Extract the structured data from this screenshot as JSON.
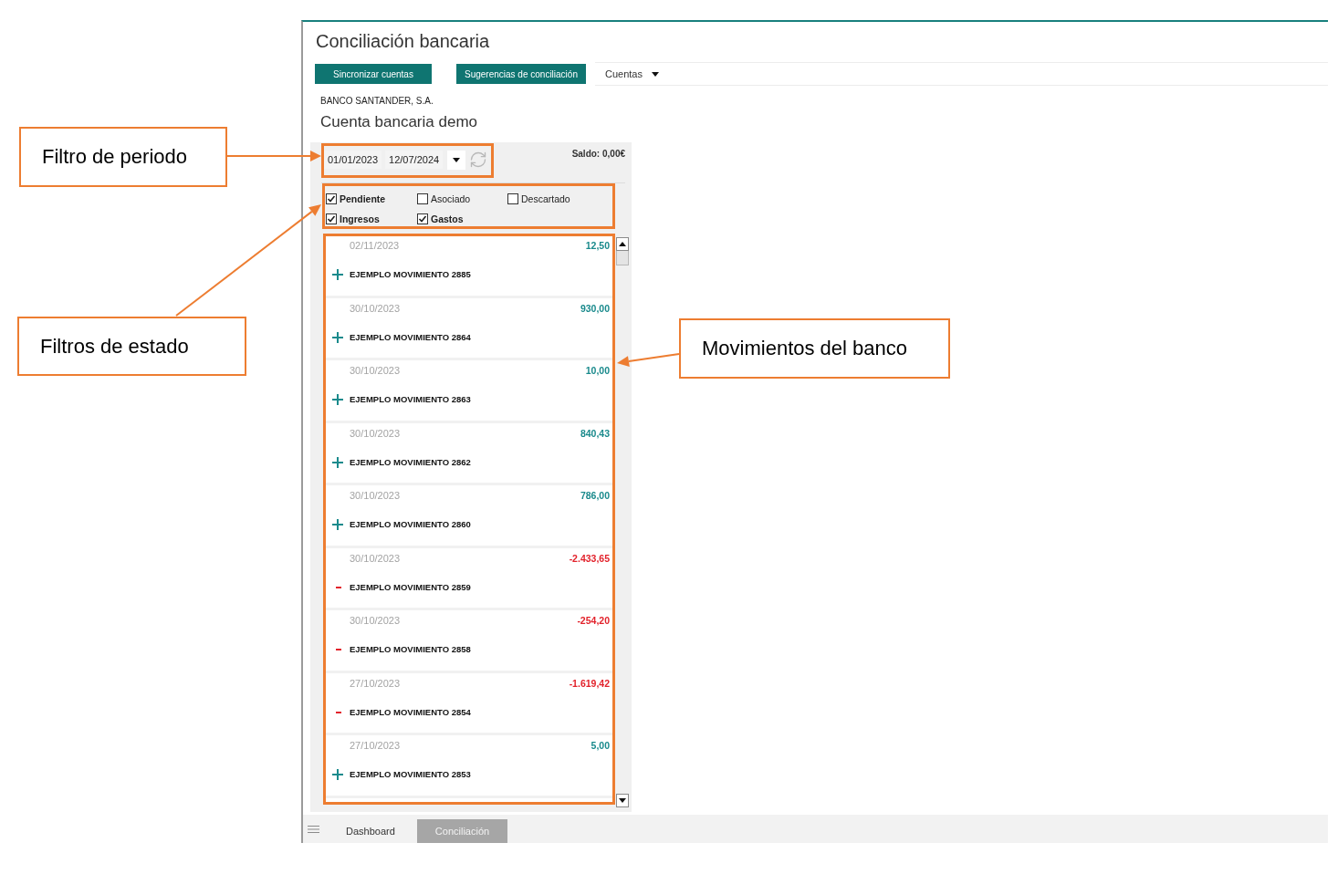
{
  "annotations": [
    {
      "text": "Filtro de periodo"
    },
    {
      "text": "Filtros de estado"
    },
    {
      "text": "Movimientos del banco"
    }
  ],
  "window": {
    "title": "Conciliación bancaria"
  },
  "toolbar": {
    "buttons": [
      "Sincronizar cuentas",
      "Sugerencias de conciliación"
    ],
    "dropdown": "Cuentas"
  },
  "account": {
    "bank": "BANCO SANTANDER, S.A.",
    "name": "Cuenta bancaria demo"
  },
  "period": {
    "from": "01/01/2023",
    "to": "12/07/2024"
  },
  "balance": "Saldo: 0,00€",
  "filters": [
    {
      "label": "Pendiente",
      "checked": true
    },
    {
      "label": "Asociado",
      "checked": false
    },
    {
      "label": "Descartado",
      "checked": false
    },
    {
      "label": "Ingresos",
      "checked": true
    },
    {
      "label": "Gastos",
      "checked": true
    }
  ],
  "movements": [
    {
      "date": "02/11/2023",
      "amount": "12,50",
      "kind": "income",
      "title": "EJEMPLO MOVIMIENTO 2885"
    },
    {
      "date": "30/10/2023",
      "amount": "930,00",
      "kind": "income",
      "title": "EJEMPLO MOVIMIENTO 2864"
    },
    {
      "date": "30/10/2023",
      "amount": "10,00",
      "kind": "income",
      "title": "EJEMPLO MOVIMIENTO 2863"
    },
    {
      "date": "30/10/2023",
      "amount": "840,43",
      "kind": "income",
      "title": "EJEMPLO MOVIMIENTO 2862"
    },
    {
      "date": "30/10/2023",
      "amount": "786,00",
      "kind": "income",
      "title": "EJEMPLO MOVIMIENTO 2860"
    },
    {
      "date": "30/10/2023",
      "amount": "-2.433,65",
      "kind": "expense",
      "title": "EJEMPLO MOVIMIENTO 2859"
    },
    {
      "date": "30/10/2023",
      "amount": "-254,20",
      "kind": "expense",
      "title": "EJEMPLO MOVIMIENTO 2858"
    },
    {
      "date": "27/10/2023",
      "amount": "-1.619,42",
      "kind": "expense",
      "title": "EJEMPLO MOVIMIENTO 2854"
    },
    {
      "date": "27/10/2023",
      "amount": "5,00",
      "kind": "income",
      "title": "EJEMPLO MOVIMIENTO 2853"
    }
  ],
  "bottom_tabs": [
    {
      "label": "Dashboard",
      "selected": false
    },
    {
      "label": "Conciliación",
      "selected": true
    }
  ]
}
